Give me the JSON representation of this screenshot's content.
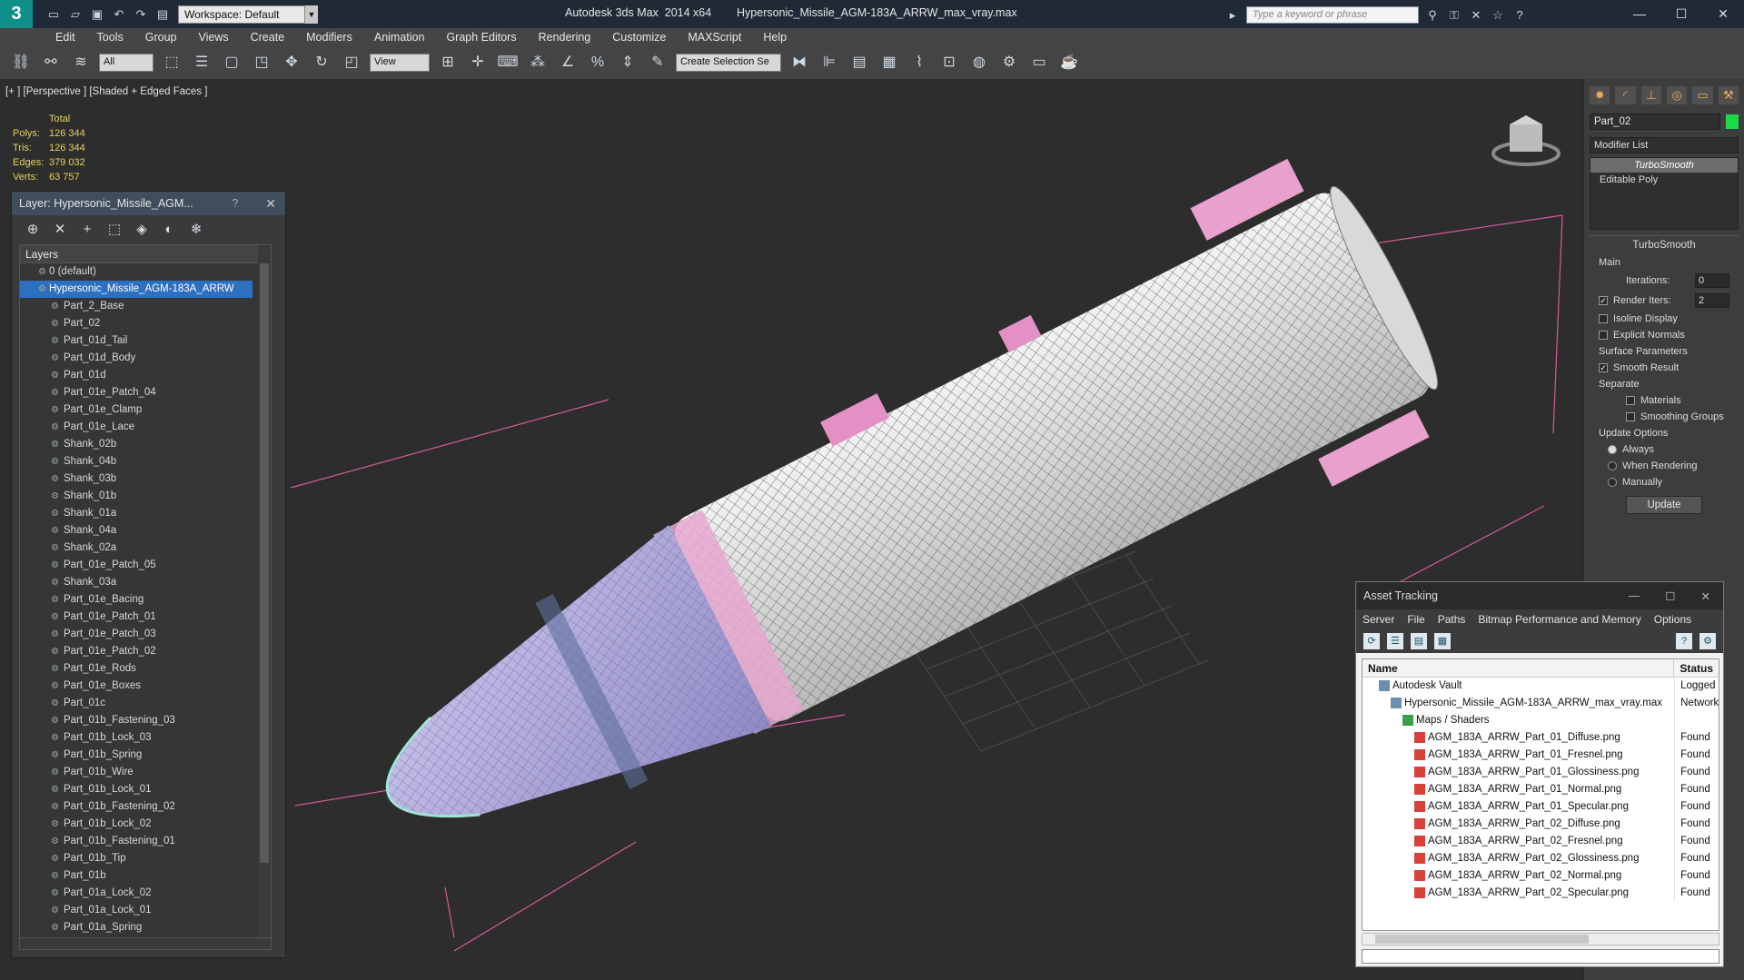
{
  "window": {
    "title": "Autodesk 3ds Max  2014 x64",
    "file": "Hypersonic_Missile_AGM-183A_ARRW_max_vray.max",
    "workspace": "Workspace: Default",
    "search_placeholder": "Type a keyword or phrase"
  },
  "menu": [
    "Edit",
    "Tools",
    "Group",
    "Views",
    "Create",
    "Modifiers",
    "Animation",
    "Graph Editors",
    "Rendering",
    "Customize",
    "MAXScript",
    "Help"
  ],
  "toolbar": {
    "filter": "All",
    "ref_coord": "View",
    "selection_set": "Create Selection Se"
  },
  "viewport": {
    "label": "[+ ] [Perspective ] [Shaded + Edged Faces ]",
    "stats_header": "Total",
    "stats": [
      {
        "k": "Polys:",
        "v": "126 344"
      },
      {
        "k": "Tris:",
        "v": "126 344"
      },
      {
        "k": "Edges:",
        "v": "379 032"
      },
      {
        "k": "Verts:",
        "v": "63 757"
      }
    ]
  },
  "layer_panel": {
    "title": "Layer: Hypersonic_Missile_AGM...",
    "help": "?",
    "column": "Layers",
    "default_layer": "0 (default)",
    "selected_layer": "Hypersonic_Missile_AGM-183A_ARRW",
    "items": [
      "Part_2_Base",
      "Part_02",
      "Part_01d_Tail",
      "Part_01d_Body",
      "Part_01d",
      "Part_01e_Patch_04",
      "Part_01e_Clamp",
      "Part_01e_Lace",
      "Shank_02b",
      "Shank_04b",
      "Shank_03b",
      "Shank_01b",
      "Shank_01a",
      "Shank_04a",
      "Shank_02a",
      "Part_01e_Patch_05",
      "Shank_03a",
      "Part_01e_Bacing",
      "Part_01e_Patch_01",
      "Part_01e_Patch_03",
      "Part_01e_Patch_02",
      "Part_01e_Rods",
      "Part_01e_Boxes",
      "Part_01c",
      "Part_01b_Fastening_03",
      "Part_01b_Lock_03",
      "Part_01b_Spring",
      "Part_01b_Wire",
      "Part_01b_Lock_01",
      "Part_01b_Fastening_02",
      "Part_01b_Lock_02",
      "Part_01b_Fastening_01",
      "Part_01b_Tip",
      "Part_01b",
      "Part_01a_Lock_02",
      "Part_01a_Lock_01",
      "Part_01a_Spring"
    ]
  },
  "command_panel": {
    "object_name": "Part_02",
    "object_color": "#1fd84a",
    "modifier_list": "Modifier List",
    "stack": [
      "TurboSmooth",
      "Editable Poly"
    ],
    "rollout_title": "TurboSmooth",
    "main_label": "Main",
    "iterations_label": "Iterations:",
    "iterations": "0",
    "render_iters_label": "Render Iters:",
    "render_iters": "2",
    "isoline": "Isoline Display",
    "explicit_normals": "Explicit Normals",
    "surface_params": "Surface Parameters",
    "smooth_result": "Smooth Result",
    "separate": "Separate",
    "materials": "Materials",
    "smoothing_groups": "Smoothing Groups",
    "update_options": "Update Options",
    "always": "Always",
    "when_rendering": "When Rendering",
    "manually": "Manually",
    "update_button": "Update"
  },
  "asset_tracking": {
    "title": "Asset Tracking",
    "menu": [
      "Server",
      "File",
      "Paths",
      "Bitmap Performance and Memory",
      "Options"
    ],
    "col_name": "Name",
    "col_status": "Status",
    "rows": [
      {
        "name": "Autodesk Vault",
        "status": "Logged (",
        "level": 0
      },
      {
        "name": "Hypersonic_Missile_AGM-183A_ARRW_max_vray.max",
        "status": "Network",
        "level": 1
      },
      {
        "name": "Maps / Shaders",
        "status": "",
        "level": 2
      },
      {
        "name": "AGM_183A_ARRW_Part_01_Diffuse.png",
        "status": "Found",
        "level": 3
      },
      {
        "name": "AGM_183A_ARRW_Part_01_Fresnel.png",
        "status": "Found",
        "level": 3
      },
      {
        "name": "AGM_183A_ARRW_Part_01_Glossiness.png",
        "status": "Found",
        "level": 3
      },
      {
        "name": "AGM_183A_ARRW_Part_01_Normal.png",
        "status": "Found",
        "level": 3
      },
      {
        "name": "AGM_183A_ARRW_Part_01_Specular.png",
        "status": "Found",
        "level": 3
      },
      {
        "name": "AGM_183A_ARRW_Part_02_Diffuse.png",
        "status": "Found",
        "level": 3
      },
      {
        "name": "AGM_183A_ARRW_Part_02_Fresnel.png",
        "status": "Found",
        "level": 3
      },
      {
        "name": "AGM_183A_ARRW_Part_02_Glossiness.png",
        "status": "Found",
        "level": 3
      },
      {
        "name": "AGM_183A_ARRW_Part_02_Normal.png",
        "status": "Found",
        "level": 3
      },
      {
        "name": "AGM_183A_ARRW_Part_02_Specular.png",
        "status": "Found",
        "level": 3
      }
    ]
  }
}
